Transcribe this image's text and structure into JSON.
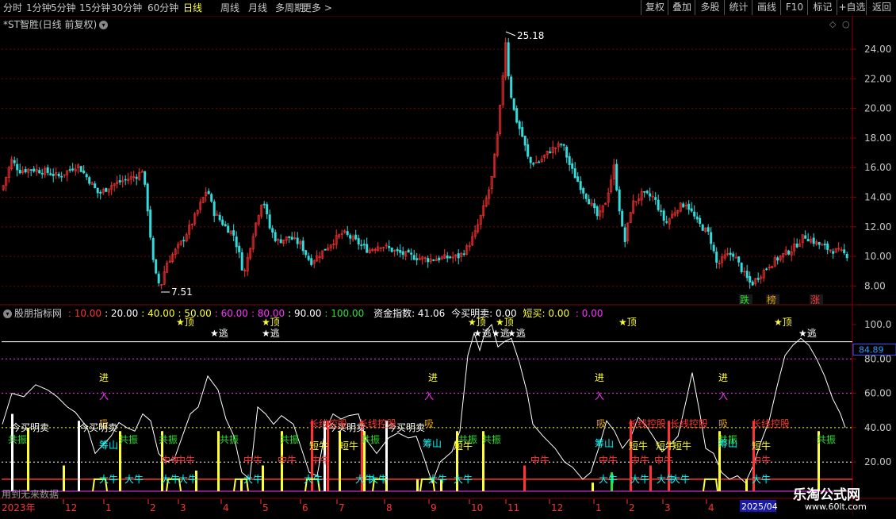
{
  "toolbar": {
    "left_items": [
      "分时",
      "1分钟",
      "5分钟",
      "15分钟",
      "30分钟",
      "60分钟",
      "日线",
      "周线",
      "月线",
      "多周期",
      "更多 >"
    ],
    "active_item": "日线",
    "right_items": [
      "复权",
      "叠加",
      "多股",
      "统计",
      "画线",
      "F10",
      "标记",
      "+自选",
      "返回"
    ]
  },
  "main_chart": {
    "title": "*ST智胜(日线 前复权)",
    "high_label": "25.18",
    "low_label": "7.51",
    "y_ticks": [
      "24.00",
      "22.00",
      "20.00",
      "18.00",
      "16.00",
      "14.00",
      "12.00",
      "10.00",
      "8.00"
    ],
    "badges": [
      {
        "text": "跌",
        "color": "#33dd33"
      },
      {
        "text": "榜",
        "color": "#e0a000"
      },
      {
        "text": "涨",
        "color": "#ff3333"
      }
    ]
  },
  "sub_header": {
    "name": "股朋指标网",
    "levels": [
      {
        "text": ": 10.00",
        "color": "#ff3333"
      },
      {
        "text": ": 20.00",
        "color": "#ffffff"
      },
      {
        "text": ": 40.00",
        "color": "#ffff33"
      },
      {
        "text": ": 50.00",
        "color": "#ffff33"
      },
      {
        "text": ": 60.00",
        "color": "#ff33ff"
      },
      {
        "text": ": 80.00",
        "color": "#ff33ff"
      },
      {
        "text": ": 90.00",
        "color": "#ffffff"
      },
      {
        "text": ": 100.00",
        "color": "#33dd33"
      }
    ],
    "fund_index": "资金指数: 41.06",
    "buy_sell": "今买明卖: 0.00",
    "short_buy": "短买: 0.00",
    "tail": ": 0.00"
  },
  "sub_chart": {
    "y_ticks": [
      "100.0",
      "80.00",
      "60.00",
      "40.00",
      "20.00"
    ],
    "current_value": "84.89",
    "labels": [
      {
        "t": "进",
        "c": "#ffff33"
      },
      {
        "t": "入",
        "c": "#ff33ff"
      },
      {
        "t": "吸",
        "c": "#e0a000"
      },
      {
        "t": "★逃",
        "c": "#ffffff"
      },
      {
        "t": "★顶",
        "c": "#ffff33"
      },
      {
        "t": "今买明卖",
        "c": "#ffffff"
      },
      {
        "t": "共振",
        "c": "#33dd33"
      },
      {
        "t": "筹山",
        "c": "#00ffff"
      },
      {
        "t": "大牛",
        "c": "#00ffff"
      },
      {
        "t": "中牛",
        "c": "#ff3333"
      },
      {
        "t": "短牛",
        "c": "#ffff33"
      },
      {
        "t": "长线控股",
        "c": "#ff3333"
      }
    ]
  },
  "date_axis": {
    "start_label": "2023年",
    "months": [
      "12",
      "1",
      "2",
      "3",
      "4",
      "5",
      "6",
      "7",
      "8",
      "9",
      "10",
      "11",
      "12",
      "1",
      "2",
      "3",
      "4"
    ],
    "end_label": "2025/04"
  },
  "history_label": "用到无来数据",
  "watermark": {
    "title": "乐淘公式网",
    "url": "www.60lt.com"
  },
  "colors": {
    "up": "#ff3333",
    "down": "#33dddd",
    "grid": "#7a0000",
    "ma": "#ff33ff"
  }
}
